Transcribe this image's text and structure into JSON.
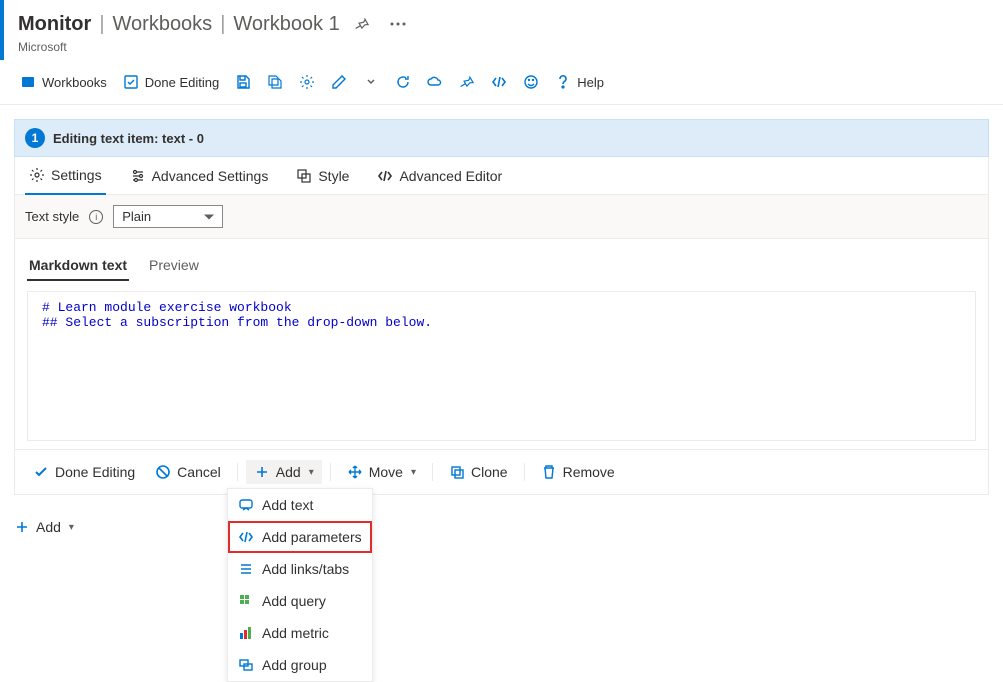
{
  "breadcrumb": {
    "segment1": "Monitor",
    "segment2": "Workbooks",
    "segment3": "Workbook 1"
  },
  "subtext": "Microsoft",
  "toolbar": {
    "workbooks": "Workbooks",
    "done_editing": "Done Editing",
    "help": "Help"
  },
  "editor": {
    "step": "1",
    "title": "Editing text item: text - 0",
    "tabs": {
      "settings": "Settings",
      "advanced_settings": "Advanced Settings",
      "style": "Style",
      "advanced_editor": "Advanced Editor"
    },
    "text_style_label": "Text style",
    "text_style_value": "Plain",
    "subtabs": {
      "markdown": "Markdown text",
      "preview": "Preview"
    },
    "code": "# Learn module exercise workbook\n## Select a subscription from the drop-down below."
  },
  "actions": {
    "done_editing": "Done Editing",
    "cancel": "Cancel",
    "add": "Add",
    "move": "Move",
    "clone": "Clone",
    "remove": "Remove"
  },
  "footer": {
    "add": "Add"
  },
  "dropdown": {
    "add_text": "Add text",
    "add_parameters": "Add parameters",
    "add_links_tabs": "Add links/tabs",
    "add_query": "Add query",
    "add_metric": "Add metric",
    "add_group": "Add group"
  }
}
